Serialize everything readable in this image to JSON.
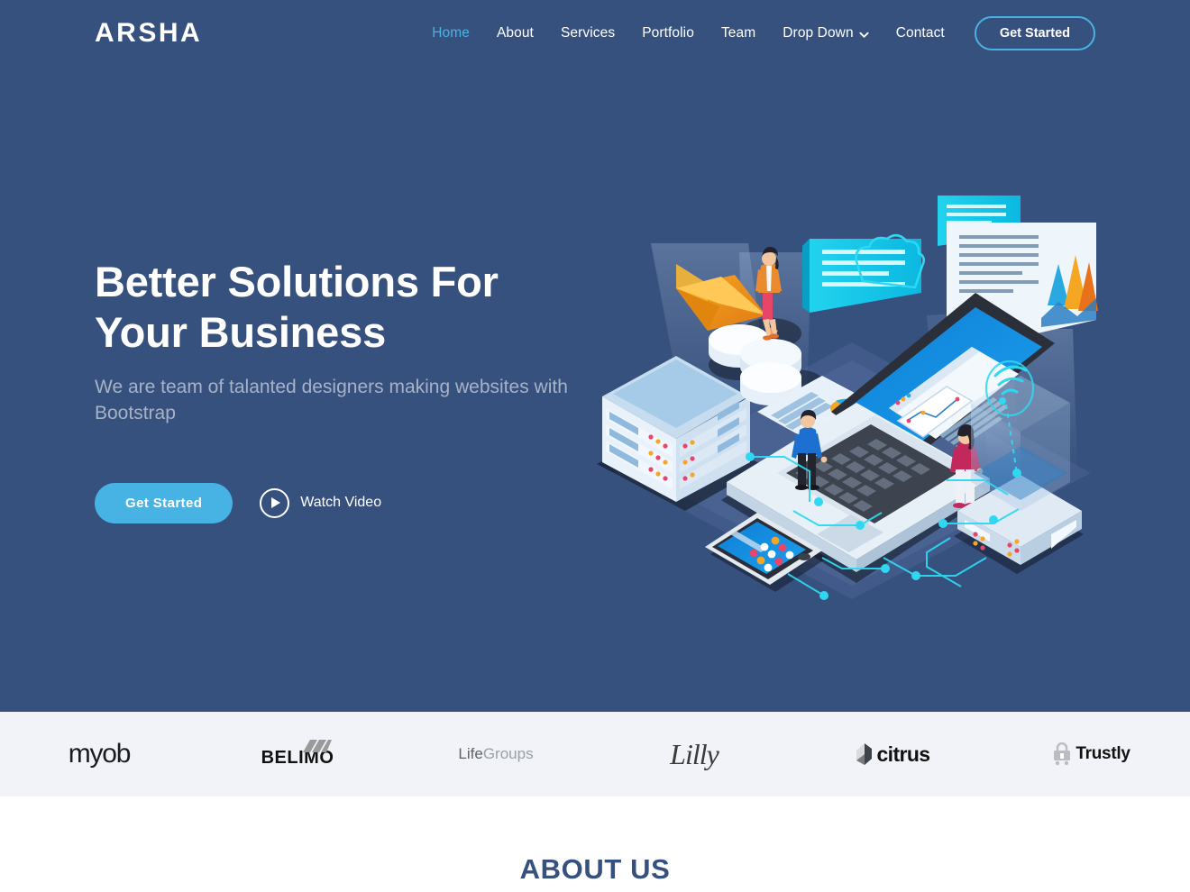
{
  "brand": {
    "name": "ARSHA"
  },
  "nav": {
    "items": [
      {
        "label": "Home",
        "active": true
      },
      {
        "label": "About",
        "active": false
      },
      {
        "label": "Services",
        "active": false
      },
      {
        "label": "Portfolio",
        "active": false
      },
      {
        "label": "Team",
        "active": false
      },
      {
        "label": "Drop Down",
        "active": false,
        "icon": "chevron-down-icon"
      },
      {
        "label": "Contact",
        "active": false
      }
    ],
    "cta_label": "Get Started"
  },
  "hero": {
    "title_line1": "Better Solutions For",
    "title_line2": "Your Business",
    "subtitle": "We are team of talanted designers making websites with Bootstrap",
    "primary_button": "Get Started",
    "video_link": "Watch Video",
    "video_icon": "play-icon",
    "illustration": "isometric-devices-team-illustration"
  },
  "clients": [
    {
      "name": "myob"
    },
    {
      "name": "BELIMO"
    },
    {
      "name": "LifeGroups"
    },
    {
      "name": "Lilly"
    },
    {
      "name": "citrus"
    },
    {
      "name": "Trustly"
    }
  ],
  "about": {
    "title": "ABOUT US"
  },
  "colors": {
    "hero_bg": "#37517e",
    "accent": "#47b2e4",
    "clients_bg": "#f1f3f8",
    "muted_text": "#a7b2c7",
    "heading": "#37517e"
  }
}
